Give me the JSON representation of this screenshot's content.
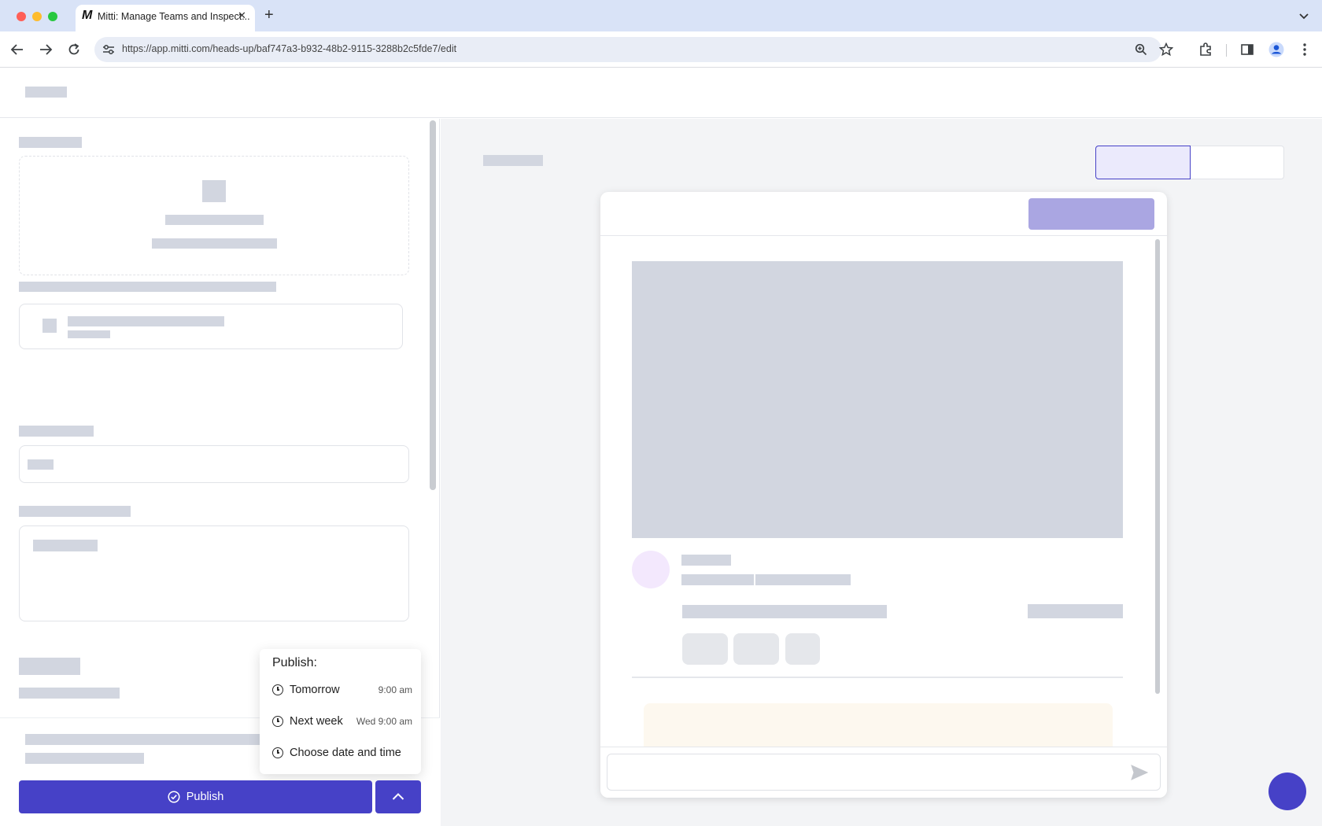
{
  "browser": {
    "tab_title": "Mitti: Manage Teams and Inspect...",
    "tab_close": "✕",
    "new_tab": "+",
    "url": "https://app.mitti.com/heads-up/baf747a3-b932-48b2-9115-3288b2c5fde7/edit",
    "favicon_letter": "M"
  },
  "publish_menu": {
    "title": "Publish:",
    "options": [
      {
        "label": "Tomorrow",
        "time": "9:00 am"
      },
      {
        "label": "Next week",
        "time": "Wed 9:00 am"
      },
      {
        "label": "Choose date and time",
        "time": ""
      }
    ]
  },
  "footer": {
    "publish_label": "Publish"
  },
  "colors": {
    "primary": "#4641c7",
    "preview_button": "#aaa6e2",
    "toggle_active": "#ebeafc",
    "avatar": "#f3e8fd",
    "notice": "#fdf8ef"
  },
  "icons": {
    "back": "arrow-left-icon",
    "forward": "arrow-right-icon",
    "reload": "reload-icon",
    "site_settings": "tune-icon",
    "zoom": "zoom-icon",
    "bookmark": "star-icon",
    "extensions": "puzzle-icon",
    "side_panel": "sidepanel-icon",
    "profile": "profile-icon",
    "menu": "kebab-menu-icon",
    "send": "send-icon",
    "clock": "clock-icon",
    "publish": "check-circle-icon",
    "expand": "chevron-up-icon"
  }
}
